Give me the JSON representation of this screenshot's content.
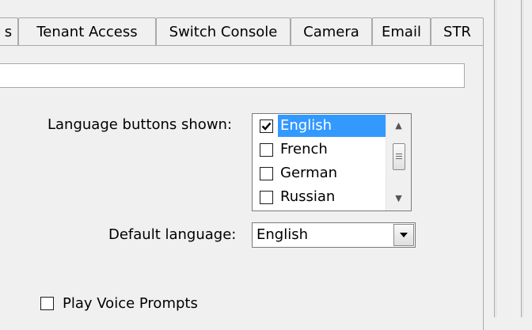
{
  "tabs": [
    {
      "label": "s"
    },
    {
      "label": "Tenant Access"
    },
    {
      "label": "Switch Console"
    },
    {
      "label": "Camera"
    },
    {
      "label": "Email"
    },
    {
      "label": "STR"
    }
  ],
  "path_field": {
    "value": ""
  },
  "language": {
    "label": "Language buttons shown:",
    "items": [
      {
        "label": "English",
        "checked": true,
        "selected": true
      },
      {
        "label": "French",
        "checked": false
      },
      {
        "label": "German",
        "checked": false
      },
      {
        "label": "Russian",
        "checked": false
      }
    ],
    "scroll_up_icon": "scroll-up-arrow",
    "scroll_down_icon": "scroll-down-arrow"
  },
  "default_language": {
    "label": "Default language:",
    "value": "English",
    "dropdown_icon": "chevron-down"
  },
  "voice_prompts": {
    "label": "Play Voice Prompts",
    "checked": false
  },
  "colors": {
    "selection": "#3399ff",
    "background": "#f0f0f0"
  }
}
